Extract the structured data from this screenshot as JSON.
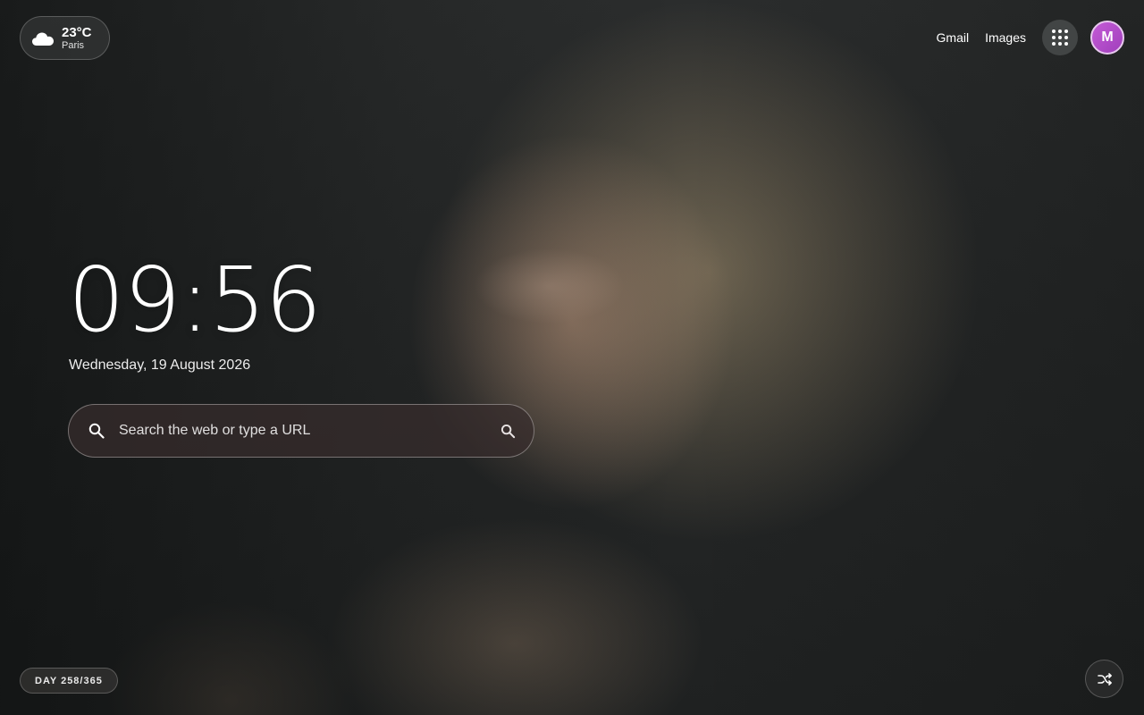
{
  "weather": {
    "temperature": "23°C",
    "city": "Paris",
    "icon": "cloud-icon"
  },
  "header": {
    "links": [
      "Gmail",
      "Images"
    ],
    "apps_icon": "apps-grid-icon",
    "avatar_initial": "M",
    "avatar_color": "#b64fcb"
  },
  "clock": {
    "time": "09:56",
    "date": "Wednesday, 19 August 2026"
  },
  "search": {
    "placeholder": "Search the web or type a URL",
    "value": ""
  },
  "footer": {
    "day_badge": "DAY 258/365",
    "shuffle_icon": "shuffle-icon"
  }
}
